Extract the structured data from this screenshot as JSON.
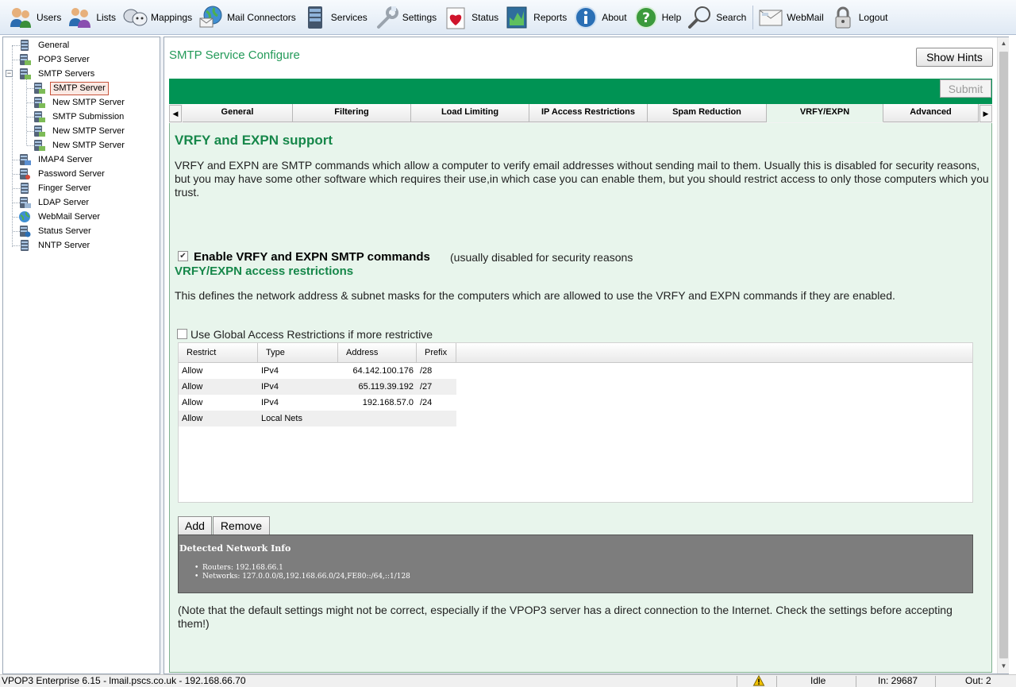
{
  "toolbar": {
    "items": [
      {
        "label": "Users",
        "icon": "users-icon"
      },
      {
        "label": "Lists",
        "icon": "lists-icon"
      },
      {
        "label": "Mappings",
        "icon": "mappings-icon"
      },
      {
        "label": "Mail Connectors",
        "icon": "mail-connectors-icon"
      },
      {
        "label": "Services",
        "icon": "services-icon"
      },
      {
        "label": "Settings",
        "icon": "settings-icon"
      },
      {
        "label": "Status",
        "icon": "status-icon"
      },
      {
        "label": "Reports",
        "icon": "reports-icon"
      },
      {
        "label": "About",
        "icon": "about-icon"
      },
      {
        "label": "Help",
        "icon": "help-icon"
      },
      {
        "label": "Search",
        "icon": "search-icon"
      },
      {
        "label": "WebMail",
        "icon": "webmail-icon"
      },
      {
        "label": "Logout",
        "icon": "logout-icon"
      }
    ]
  },
  "tree": {
    "items": [
      {
        "label": "General",
        "level": 0
      },
      {
        "label": "POP3 Server",
        "level": 0
      },
      {
        "label": "SMTP Servers",
        "level": 0,
        "expanded": true
      },
      {
        "label": "SMTP Server",
        "level": 1,
        "selected": true
      },
      {
        "label": "New SMTP Server",
        "level": 1
      },
      {
        "label": "SMTP Submission",
        "level": 1
      },
      {
        "label": "New SMTP Server",
        "level": 1
      },
      {
        "label": "New SMTP Server",
        "level": 1
      },
      {
        "label": "IMAP4 Server",
        "level": 0
      },
      {
        "label": "Password Server",
        "level": 0
      },
      {
        "label": "Finger Server",
        "level": 0
      },
      {
        "label": "LDAP Server",
        "level": 0
      },
      {
        "label": "WebMail Server",
        "level": 0
      },
      {
        "label": "Status Server",
        "level": 0
      },
      {
        "label": "NNTP Server",
        "level": 0
      }
    ]
  },
  "main": {
    "title": "SMTP Service Configure",
    "show_hints_label": "Show Hints",
    "submit_label": "Submit",
    "tabs": [
      "General",
      "Filtering",
      "Load Limiting",
      "IP Access Restrictions",
      "Spam Reduction",
      "VRFY/EXPN",
      "Advanced"
    ],
    "active_tab": "VRFY/EXPN",
    "content": {
      "heading": "VRFY and EXPN support",
      "description": "VRFY and EXPN are SMTP commands which allow a computer to verify email addresses without sending mail to them. Usually this is disabled for security reasons, but you may have some other software which requires their use,in which case you can enable them, but you should restrict access to only those computers which you trust.",
      "enable_checkbox": {
        "checked": true,
        "label": "Enable VRFY and EXPN SMTP commands",
        "note": "(usually disabled for security reasons"
      },
      "subheading": "VRFY/EXPN access restrictions",
      "subdescription": "This defines the network address & subnet masks for the computers which are allowed to use the VRFY and EXPN commands if they are enabled.",
      "global_checkbox": {
        "checked": false,
        "label": "Use Global Access Restrictions if more restrictive"
      },
      "table": {
        "columns": [
          "Restrict",
          "Type",
          "Address",
          "Prefix"
        ],
        "rows": [
          [
            "Allow",
            "IPv4",
            "64.142.100.176",
            "/28"
          ],
          [
            "Allow",
            "IPv4",
            "65.119.39.192",
            "/27"
          ],
          [
            "Allow",
            "IPv4",
            "192.168.57.0",
            "/24"
          ],
          [
            "Allow",
            "Local Nets",
            "",
            ""
          ]
        ]
      },
      "add_label": "Add",
      "remove_label": "Remove",
      "network_info": {
        "title": "Detected Network Info",
        "routers": "Routers: 192.168.66.1",
        "networks": "Networks: 127.0.0.0/8,192.168.66.0/24,FE80::/64,::1/128"
      },
      "note": "(Note that the default settings might not be correct, especially if the VPOP3 server has a direct connection to the Internet. Check the settings before accepting them!)"
    }
  },
  "statusbar": {
    "app_info": "VPOP3 Enterprise 6.15 - lmail.pscs.co.uk - 192.168.66.70",
    "state": "Idle",
    "in": "In: 29687",
    "out": "Out: 2"
  },
  "colors": {
    "accent_green": "#009354",
    "heading_green": "#16874a",
    "content_bg": "#e8f5ec",
    "network_info_bg": "#7d7d7d"
  }
}
